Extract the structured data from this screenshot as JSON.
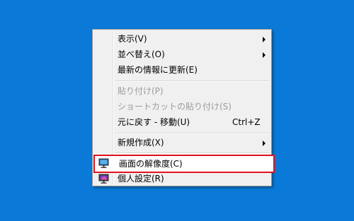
{
  "context_menu": {
    "items": [
      {
        "label": "表示(V)",
        "has_submenu": true
      },
      {
        "label": "並べ替え(O)",
        "has_submenu": true
      },
      {
        "label": "最新の情報に更新(E)"
      },
      {
        "label": "貼り付け(P)",
        "disabled": true
      },
      {
        "label": "ショートカットの貼り付け(S)",
        "disabled": true
      },
      {
        "label": "元に戻す - 移動(U)",
        "shortcut": "Ctrl+Z"
      },
      {
        "label": "新規作成(X)",
        "has_submenu": true
      },
      {
        "label": "画面の解像度(C)",
        "icon": "display-icon",
        "highlighted": true
      },
      {
        "label": "個人設定(R)",
        "icon": "personalize-icon"
      }
    ]
  },
  "colors": {
    "desktop": "#0b79d7",
    "menu_background": "#f0f0f0",
    "highlight_border": "#e0141e",
    "disabled_text": "#9b9b9b"
  }
}
